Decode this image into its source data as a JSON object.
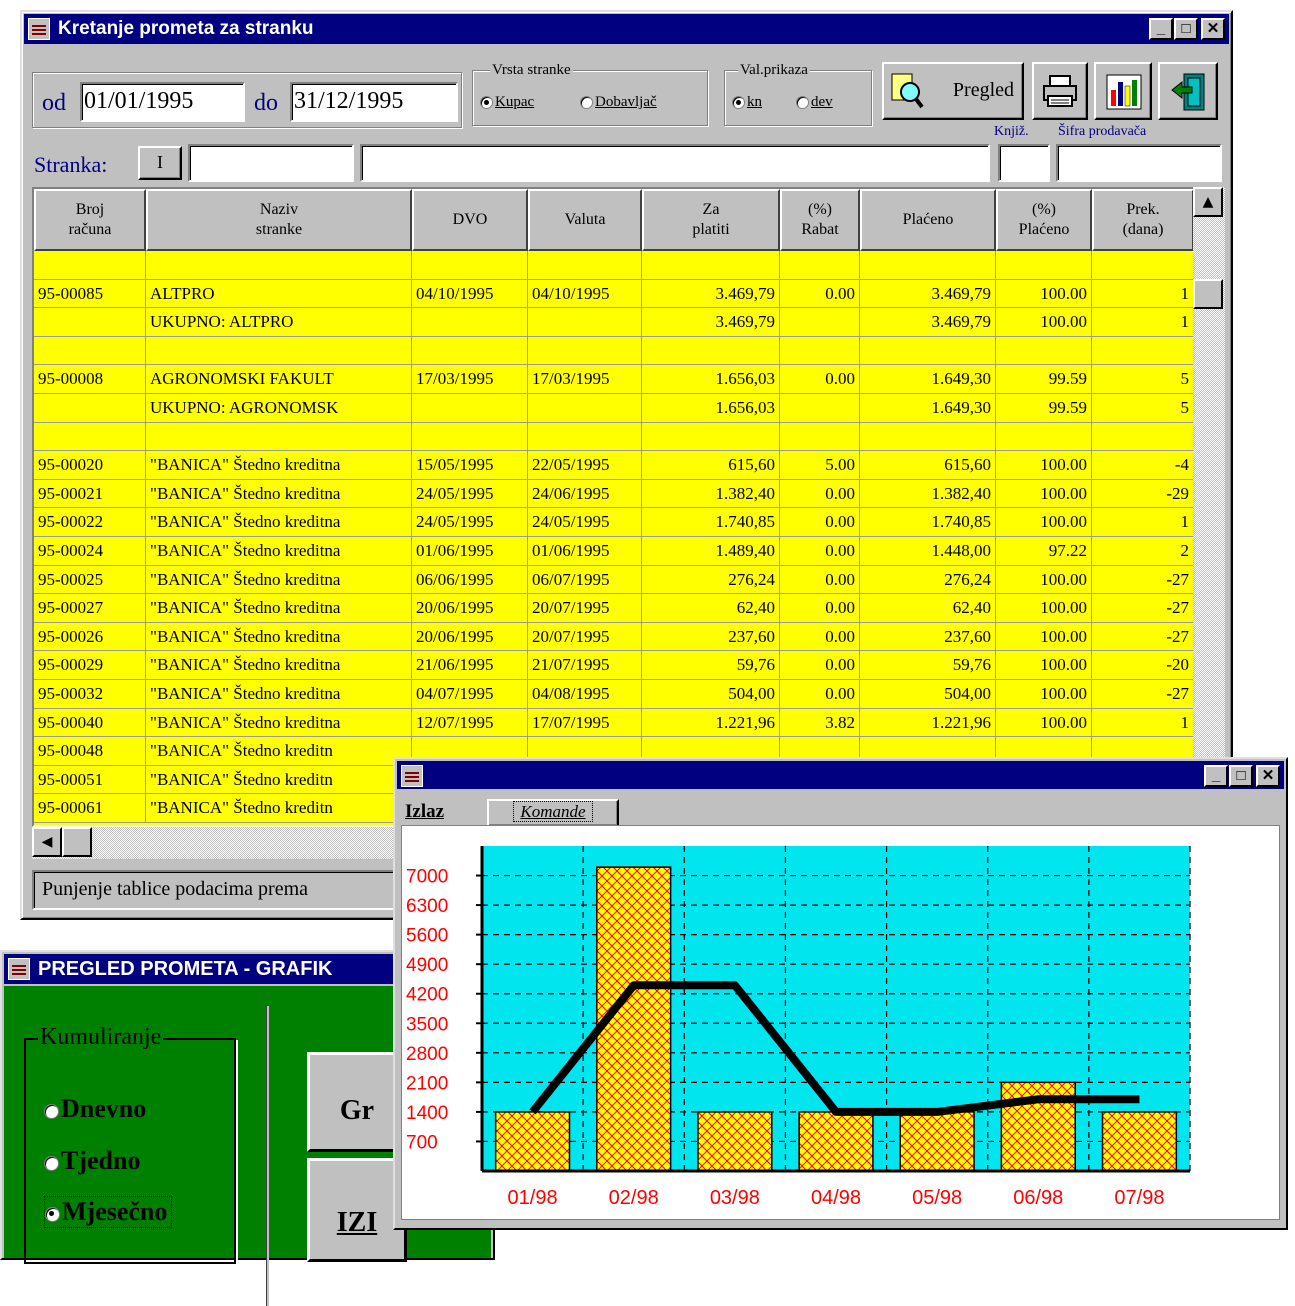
{
  "main_window": {
    "title": "Kretanje prometa za stranku",
    "od_label": "od",
    "date_from": "01/01/1995",
    "do_label": "do",
    "date_to": "31/12/1995",
    "vrsta_stranke": {
      "caption": "Vrsta stranke",
      "options": [
        "Kupac",
        "Dobavljač"
      ],
      "selected": "Kupac"
    },
    "val_prikaza": {
      "caption": "Val.prikaza",
      "options": [
        "kn",
        "dev"
      ],
      "selected": "kn"
    },
    "pregled_label": "Pregled",
    "knjiz_label": "Knjiž.",
    "sifra_label": "Šifra prodavača",
    "stranka_label": "Stranka:",
    "stranka_btn": "I",
    "status_text": "Punjenje tablice podacima prema",
    "columns": [
      "Broj računa",
      "Naziv stranke",
      "DVO",
      "Valuta",
      "Za platiti",
      "(%) Rabat",
      "Plaćeno",
      "(%) Plaćeno",
      "Prek. (dana)"
    ],
    "rows": [
      [
        "",
        "",
        "",
        "",
        "",
        "",
        "",
        "",
        ""
      ],
      [
        "95-00085",
        "ALTPRO",
        "04/10/1995",
        "04/10/1995",
        "3.469,79",
        "0.00",
        "3.469,79",
        "100.00",
        "1"
      ],
      [
        "",
        "UKUPNO: ALTPRO",
        "",
        "",
        "3.469,79",
        "",
        "3.469,79",
        "100.00",
        "1"
      ],
      [
        "",
        "",
        "",
        "",
        "",
        "",
        "",
        "",
        ""
      ],
      [
        "95-00008",
        "AGRONOMSKI FAKULT",
        "17/03/1995",
        "17/03/1995",
        "1.656,03",
        "0.00",
        "1.649,30",
        "99.59",
        "5"
      ],
      [
        "",
        "UKUPNO: AGRONOMSK",
        "",
        "",
        "1.656,03",
        "",
        "1.649,30",
        "99.59",
        "5"
      ],
      [
        "",
        "",
        "",
        "",
        "",
        "",
        "",
        "",
        ""
      ],
      [
        "95-00020",
        "\"BANICA\" Štedno kreditna",
        "15/05/1995",
        "22/05/1995",
        "615,60",
        "5.00",
        "615,60",
        "100.00",
        "-4"
      ],
      [
        "95-00021",
        "\"BANICA\" Štedno kreditna",
        "24/05/1995",
        "24/06/1995",
        "1.382,40",
        "0.00",
        "1.382,40",
        "100.00",
        "-29"
      ],
      [
        "95-00022",
        "\"BANICA\" Štedno kreditna",
        "24/05/1995",
        "24/05/1995",
        "1.740,85",
        "0.00",
        "1.740,85",
        "100.00",
        "1"
      ],
      [
        "95-00024",
        "\"BANICA\" Štedno kreditna",
        "01/06/1995",
        "01/06/1995",
        "1.489,40",
        "0.00",
        "1.448,00",
        "97.22",
        "2"
      ],
      [
        "95-00025",
        "\"BANICA\" Štedno kreditna",
        "06/06/1995",
        "06/07/1995",
        "276,24",
        "0.00",
        "276,24",
        "100.00",
        "-27"
      ],
      [
        "95-00027",
        "\"BANICA\" Štedno kreditna",
        "20/06/1995",
        "20/07/1995",
        "62,40",
        "0.00",
        "62,40",
        "100.00",
        "-27"
      ],
      [
        "95-00026",
        "\"BANICA\" Štedno kreditna",
        "20/06/1995",
        "20/07/1995",
        "237,60",
        "0.00",
        "237,60",
        "100.00",
        "-27"
      ],
      [
        "95-00029",
        "\"BANICA\" Štedno kreditna",
        "21/06/1995",
        "21/07/1995",
        "59,76",
        "0.00",
        "59,76",
        "100.00",
        "-20"
      ],
      [
        "95-00032",
        "\"BANICA\" Štedno kreditna",
        "04/07/1995",
        "04/08/1995",
        "504,00",
        "0.00",
        "504,00",
        "100.00",
        "-27"
      ],
      [
        "95-00040",
        "\"BANICA\" Štedno kreditna",
        "12/07/1995",
        "17/07/1995",
        "1.221,96",
        "3.82",
        "1.221,96",
        "100.00",
        "1"
      ],
      [
        "95-00048",
        "\"BANICA\" Štedno kreditn",
        "",
        "",
        "",
        "",
        "",
        "",
        ""
      ],
      [
        "95-00051",
        "\"BANICA\" Štedno kreditn",
        "",
        "",
        "",
        "",
        "",
        "",
        ""
      ],
      [
        "95-00061",
        "\"BANICA\" Štedno kreditn",
        "",
        "",
        "",
        "",
        "",
        "",
        ""
      ]
    ]
  },
  "green_window": {
    "title": "PREGLED PROMETA - GRAFIK",
    "group_caption": "Kumuliranje",
    "options": [
      "Dnevno",
      "Tjedno",
      "Mjesečno"
    ],
    "selected": "Mjesečno",
    "grafik_btn": "Gr",
    "izlaz_btn": "IZI"
  },
  "chart_window": {
    "menu_izlaz": "Izlaz",
    "menu_komande": "Komande"
  },
  "colors": {
    "title_bar": "#000080",
    "grid_bg": "#ffff00",
    "chart_bg": "#00e5ee",
    "bar_fill": "#ffff00",
    "bar_hatch": "#ff0000",
    "axis_labels": "#ff0000",
    "green_bg": "#008000"
  },
  "chart_data": {
    "type": "bar",
    "categories": [
      "01/98",
      "02/98",
      "03/98",
      "04/98",
      "05/98",
      "06/98",
      "07/98"
    ],
    "series": [
      {
        "type": "bar",
        "values": [
          1400,
          7200,
          1400,
          1400,
          1400,
          2100,
          1400
        ]
      },
      {
        "type": "line",
        "values": [
          1400,
          4400,
          4400,
          1400,
          1400,
          1700,
          1700
        ]
      }
    ],
    "y_ticks": [
      700,
      1400,
      2100,
      2800,
      3500,
      4200,
      4900,
      5600,
      6300,
      7000
    ],
    "ylim": [
      0,
      7700
    ],
    "grid": true
  }
}
